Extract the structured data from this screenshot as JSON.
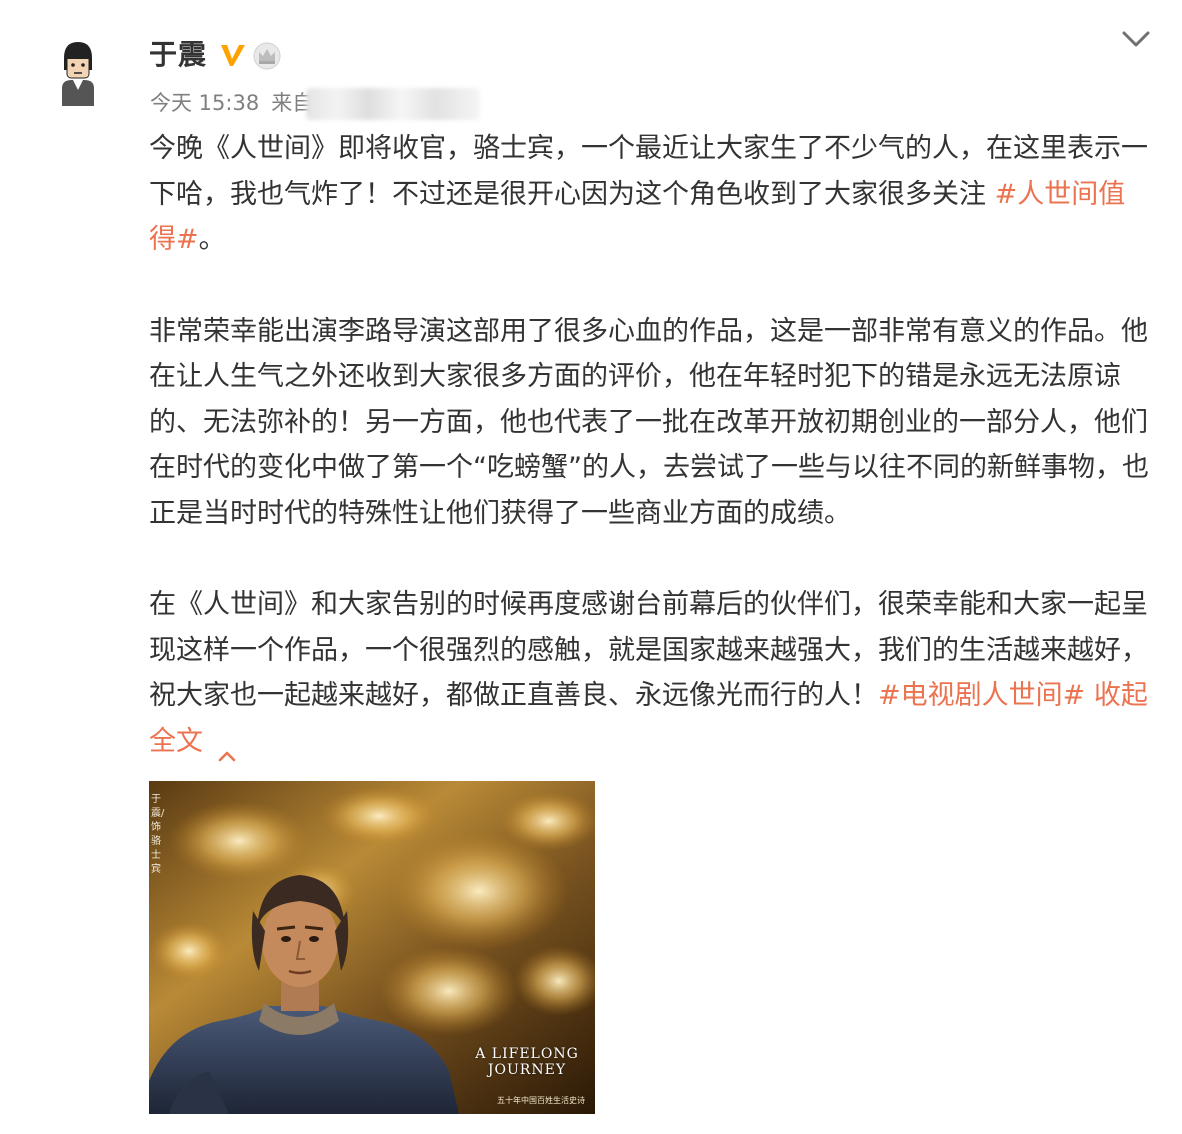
{
  "user": {
    "name": "于震",
    "verified_icon": "verified-v-icon",
    "member_icon": "crown-icon"
  },
  "meta": {
    "time": "今天 15:38",
    "source_label": "来自"
  },
  "post": {
    "paragraph1": {
      "text": "今晚《人世间》即将收官，骆士宾，一个最近让大家生了不少气的人，在这里表示一下哈，我也气炸了！不过还是很开心因为这个角色收到了大家很多关注 ",
      "tag": "#人世间值得#",
      "tail": "。"
    },
    "paragraph2": {
      "text": "非常荣幸能出演李路导演这部用了很多心血的作品，这是一部非常有意义的作品。他在让人生气之外还收到大家很多方面的评价，他在年轻时犯下的错是永远无法原谅的、无法弥补的！另一方面，他也代表了一批在改革开放初期创业的一部分人，他们在时代的变化中做了第一个“吃螃蟹”的人，去尝试了一些与以往不同的新鲜事物，也正是当时时代的特殊性让他们获得了一些商业方面的成绩。"
    },
    "paragraph3": {
      "text": "在《人世间》和大家告别的时候再度感谢台前幕后的伙伴们，很荣幸能和大家一起呈现这样一个作品，一个很强烈的感触，就是国家越来越强大，我们的生活越来越好，祝大家也一起越来越好，都做正直善良、永远像光而行的人！",
      "tag": "#电视剧人世间#",
      "collapse_label": "收起全文"
    }
  },
  "poster": {
    "title": "A LIFELONG JOURNEY",
    "vertical_text": "于震/饰骆士宾",
    "credit": "五十年中国百姓生活史诗"
  },
  "colors": {
    "accent": "#eb7350",
    "text": "#333333",
    "meta": "#808080",
    "verified": "#ffa200"
  }
}
